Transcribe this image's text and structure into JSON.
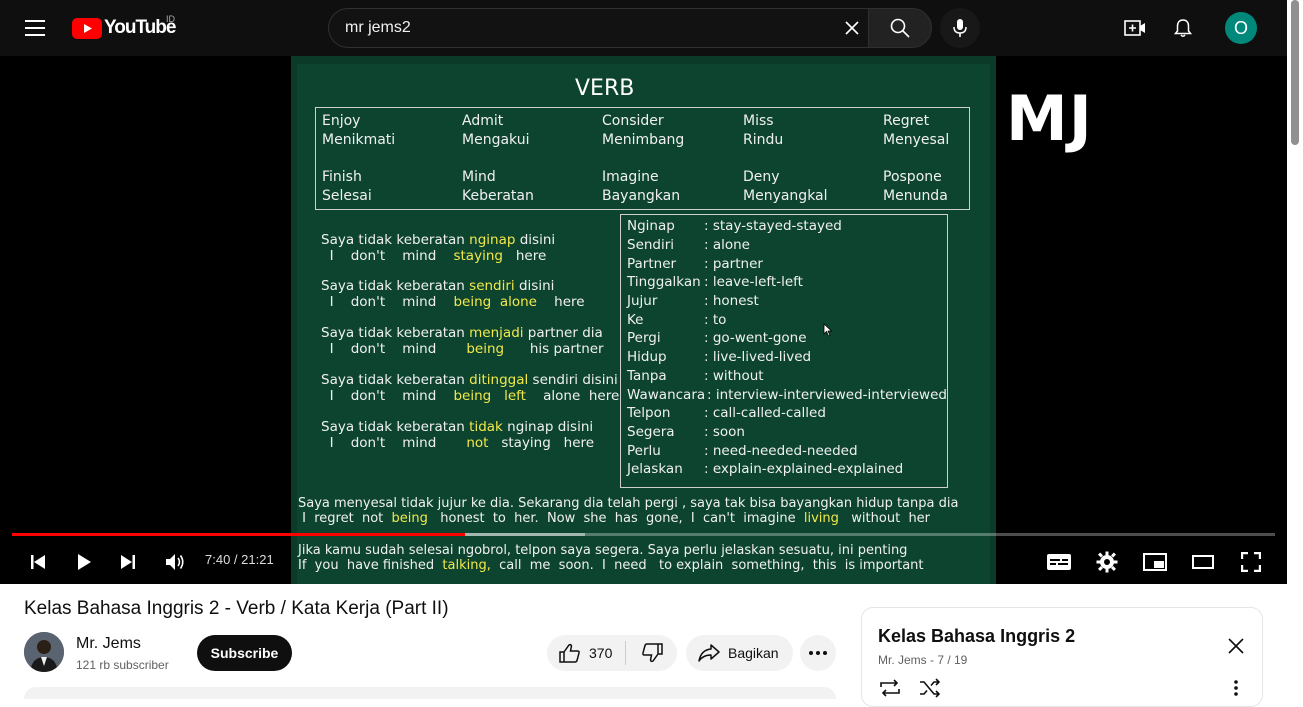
{
  "header": {
    "logo_text": "YouTube",
    "country_code": "ID",
    "search_value": "mr jems2",
    "avatar_letter": "O"
  },
  "slide": {
    "title": "VERB",
    "verbs": [
      {
        "en": "Enjoy",
        "id": "Menikmati"
      },
      {
        "en": "Admit",
        "id": "Mengakui"
      },
      {
        "en": "Consider",
        "id": "Menimbang"
      },
      {
        "en": "Miss",
        "id": "Rindu"
      },
      {
        "en": "Regret",
        "id": "Menyesal"
      },
      {
        "en": "Finish",
        "id": "Selesai"
      },
      {
        "en": "Mind",
        "id": "Keberatan"
      },
      {
        "en": "Imagine",
        "id": "Bayangkan"
      },
      {
        "en": "Deny",
        "id": "Menyangkal"
      },
      {
        "en": "Pospone",
        "id": "Menunda"
      }
    ],
    "sentences": [
      {
        "id_pre": "Saya tidak keberatan ",
        "id_hl": "nginap",
        "id_post": " disini",
        "en_pre": "  I    don't    mind    ",
        "en_hl": "staying",
        "en_post": "   here"
      },
      {
        "id_pre": "Saya tidak keberatan ",
        "id_hl": "sendiri",
        "id_post": " disini",
        "en_pre": "  I    don't    mind    ",
        "en_hl": "being  alone",
        "en_post": "    here"
      },
      {
        "id_pre": "Saya tidak keberatan ",
        "id_hl": "menjadi",
        "id_post": " partner dia",
        "en_pre": "  I    don't    mind       ",
        "en_hl": "being",
        "en_post": "      his partner"
      },
      {
        "id_pre": "Saya tidak keberatan ",
        "id_hl": "ditinggal",
        "id_post": " sendiri disini",
        "en_pre": "  I    don't    mind    ",
        "en_hl": "being   left",
        "en_post": "    alone  here"
      },
      {
        "id_pre": "Saya tidak keberatan ",
        "id_hl": "tidak",
        "id_post": " nginap disini",
        "en_pre": "  I    don't    mind       ",
        "en_hl": "not",
        "en_post": "   staying   here"
      }
    ],
    "vocab": [
      {
        "word": "Nginap",
        "def": ": stay-stayed-stayed"
      },
      {
        "word": "Sendiri",
        "def": ": alone"
      },
      {
        "word": "Partner",
        "def": ": partner"
      },
      {
        "word": "Tinggalkan",
        "def": ": leave-left-left"
      },
      {
        "word": "Jujur",
        "def": ": honest"
      },
      {
        "word": "Ke",
        "def": ": to"
      },
      {
        "word": "Pergi",
        "def": ": go-went-gone"
      },
      {
        "word": "Hidup",
        "def": ": live-lived-lived"
      },
      {
        "word": "Tanpa",
        "def": ": without"
      },
      {
        "word": "Wawancara",
        "def": " : interview-interviewed-interviewed"
      },
      {
        "word": "Telpon",
        "def": ": call-called-called"
      },
      {
        "word": "Segera",
        "def": ": soon"
      },
      {
        "word": "Perlu",
        "def": ": need-needed-needed"
      },
      {
        "word": "Jelaskan",
        "def": ": explain-explained-explained"
      }
    ],
    "bottom1_id": "Saya menyesal tidak jujur ke dia. Sekarang dia telah pergi , saya tak bisa bayangkan hidup tanpa dia",
    "bottom1_en_a": " I  regret  not  ",
    "bottom1_en_hl1": "being",
    "bottom1_en_b": "   honest  to  her.  Now  she  has  gone,  I  can't  imagine  ",
    "bottom1_en_hl2": "living",
    "bottom1_en_c": "   without  her",
    "bottom2_id": "Jika kamu sudah selesai ngobrol, telpon saya segera.  Saya perlu jelaskan sesuatu, ini penting",
    "bottom2_en_a": "If  you  have finished  ",
    "bottom2_en_hl": "talking,",
    "bottom2_en_b": "  call  me  soon.  I  need   to explain  something,  this  is important",
    "watermark": "MJ"
  },
  "player": {
    "time": "7:40 / 21:21",
    "progress_played": 0.359,
    "progress_buffered": 0.454
  },
  "video": {
    "title": "Kelas Bahasa Inggris 2 - Verb / Kata Kerja (Part II)",
    "channel": "Mr. Jems",
    "subscribers": "121 rb subscriber",
    "subscribe_label": "Subscribe",
    "likes": "370",
    "share_label": "Bagikan"
  },
  "playlist": {
    "title": "Kelas Bahasa Inggris 2",
    "meta": "Mr. Jems - 7 / 19"
  },
  "colors": {
    "youtube_red": "#ff0000",
    "chalkboard": "#0d4430",
    "highlight": "#f2e84a",
    "avatar_bg": "#00897b"
  }
}
